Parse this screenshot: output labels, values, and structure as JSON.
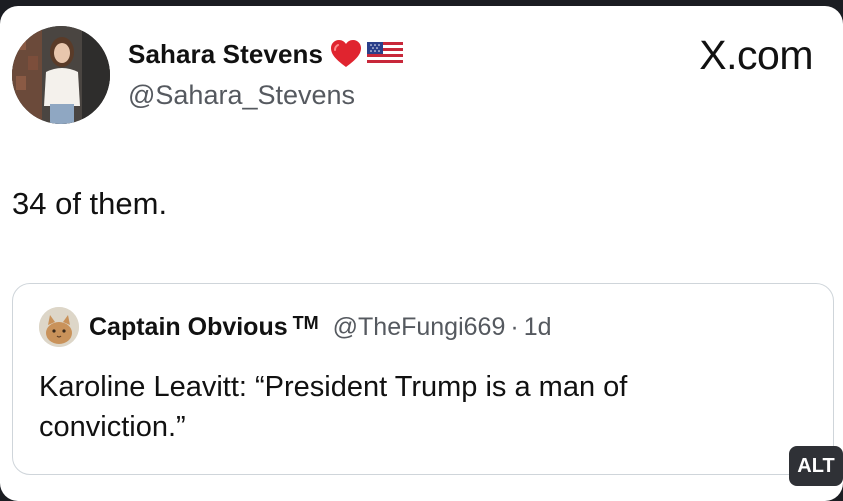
{
  "post": {
    "author_name": "Sahara Stevens",
    "author_handle": "@Sahara_Stevens",
    "site_label": "X.com",
    "text": "34 of them.",
    "icons": [
      "avatar-photo",
      "red-heart-icon",
      "us-flag-icon"
    ]
  },
  "quoted_post": {
    "author_name": "Captain Obvious",
    "author_badge": "TM",
    "author_handle": "@TheFungi669",
    "separator": "·",
    "time": "1d",
    "text": "Karoline Leavitt: “President Trump is a man of conviction.”"
  },
  "alt_badge": {
    "label": "ALT"
  },
  "colors": {
    "frame": "#1b1d22",
    "card": "#ffffff",
    "text": "#111111",
    "muted_text": "#55595f",
    "quote_border": "#cfd5da",
    "alt_badge_bg": "#2f3136",
    "heart": "#e0242f"
  }
}
